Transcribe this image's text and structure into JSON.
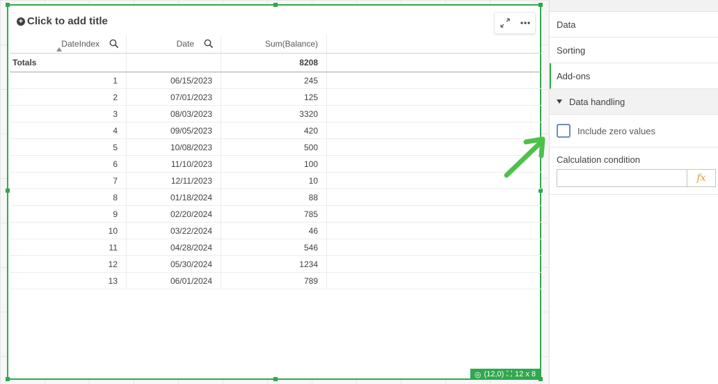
{
  "object": {
    "title": "Click to add title",
    "status": {
      "coords": "(12,0)",
      "size": "12 x 8"
    }
  },
  "table": {
    "headers": [
      "DateIndex",
      "Date",
      "Sum(Balance)"
    ],
    "totals": {
      "label": "Totals",
      "value": "8208"
    },
    "rows": [
      [
        "1",
        "06/15/2023",
        "245"
      ],
      [
        "2",
        "07/01/2023",
        "125"
      ],
      [
        "3",
        "08/03/2023",
        "3320"
      ],
      [
        "4",
        "09/05/2023",
        "420"
      ],
      [
        "5",
        "10/08/2023",
        "500"
      ],
      [
        "6",
        "11/10/2023",
        "100"
      ],
      [
        "7",
        "12/11/2023",
        "10"
      ],
      [
        "8",
        "01/18/2024",
        "88"
      ],
      [
        "9",
        "02/20/2024",
        "785"
      ],
      [
        "10",
        "03/22/2024",
        "46"
      ],
      [
        "11",
        "04/28/2024",
        "546"
      ],
      [
        "12",
        "05/30/2024",
        "1234"
      ],
      [
        "13",
        "06/01/2024",
        "789"
      ]
    ]
  },
  "panel": {
    "items": [
      "Data",
      "Sorting",
      "Add-ons"
    ],
    "section": "Data handling",
    "checkbox_label": "Include zero values",
    "calc_label": "Calculation condition",
    "fx_label": "fx"
  },
  "colors": {
    "accent": "#2fa84f",
    "fx": "#e79a3a",
    "checkbox_border": "#6a8ebc"
  }
}
